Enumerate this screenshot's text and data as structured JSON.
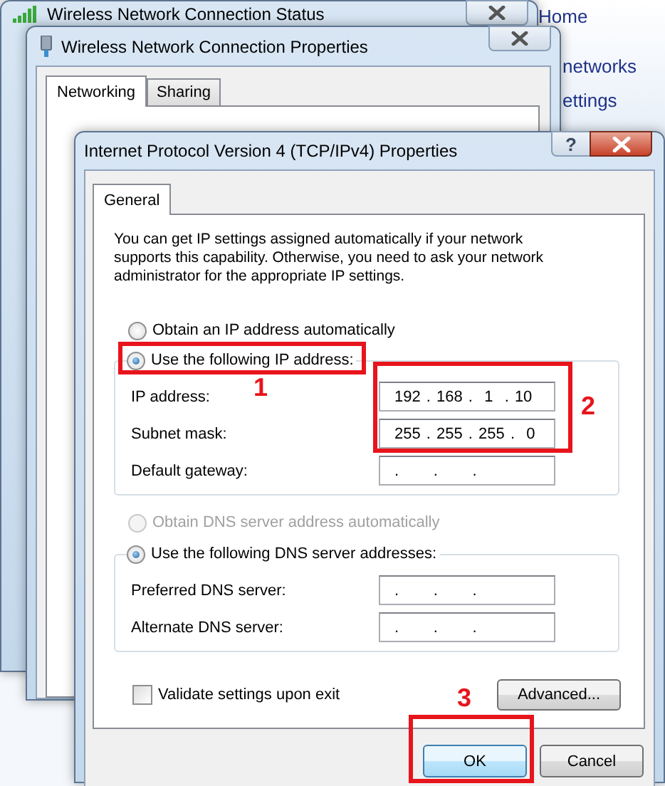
{
  "background_panel": {
    "links": [
      "Home",
      "networks",
      "ettings"
    ]
  },
  "status_window": {
    "title": "Wireless Network Connection Status"
  },
  "properties_window": {
    "title": "Wireless Network Connection Properties",
    "tabs": [
      {
        "label": "Networking",
        "selected": true
      },
      {
        "label": "Sharing",
        "selected": false
      }
    ]
  },
  "ipv4_dialog": {
    "title": "Internet Protocol Version 4 (TCP/IPv4) Properties",
    "help_button": "?",
    "tabs": [
      {
        "label": "General",
        "selected": true
      }
    ],
    "description": "You can get IP settings assigned automatically if your network supports this capability. Otherwise, you need to ask your network administrator for the appropriate IP settings.",
    "ip_options": [
      {
        "label": "Obtain an IP address automatically",
        "selected": false,
        "disabled": false
      },
      {
        "label": "Use the following IP address:",
        "selected": true,
        "disabled": false
      }
    ],
    "ip_fields": [
      {
        "label": "IP address:",
        "value": "192 . 168 .  1  . 10"
      },
      {
        "label": "Subnet mask:",
        "value": "255 . 255 . 255 .  0"
      },
      {
        "label": "Default gateway:",
        "value": ".      .      ."
      }
    ],
    "dns_options": [
      {
        "label": "Obtain DNS server address automatically",
        "selected": false,
        "disabled": true
      },
      {
        "label": "Use the following DNS server addresses:",
        "selected": true,
        "disabled": false
      }
    ],
    "dns_fields": [
      {
        "label": "Preferred DNS server:",
        "value": ".      .      ."
      },
      {
        "label": "Alternate DNS server:",
        "value": ".      .      ."
      }
    ],
    "validate": {
      "label": "Validate settings upon exit",
      "checked": false
    },
    "advanced_button": "Advanced...",
    "buttons": [
      {
        "label": "OK",
        "kind": "default"
      },
      {
        "label": "Cancel",
        "kind": "normal"
      }
    ]
  },
  "annotations": [
    "1",
    "2",
    "3"
  ]
}
